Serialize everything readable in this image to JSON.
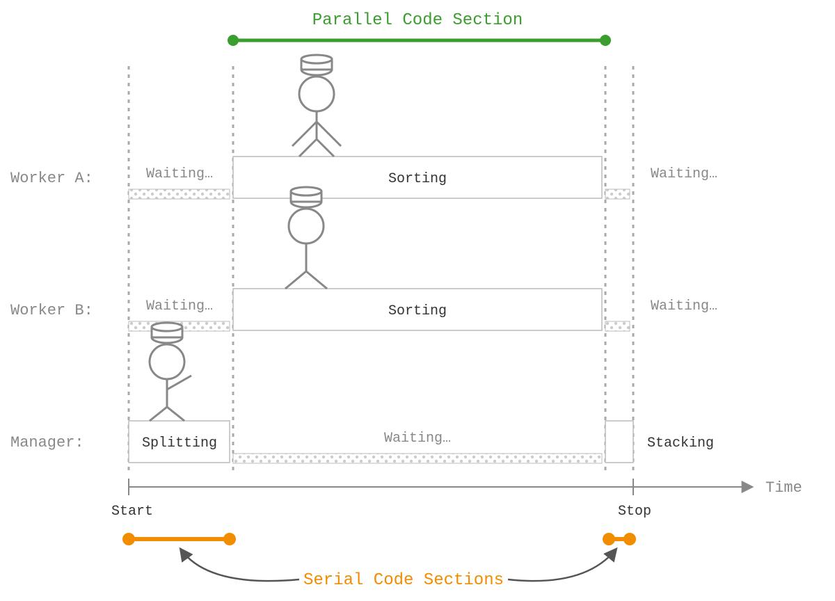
{
  "title_parallel": "Parallel Code Section",
  "title_serial": "Serial Code Sections",
  "axis_label": "Time",
  "tick_start": "Start",
  "tick_stop": "Stop",
  "lanes": {
    "workerA": {
      "label": "Worker A:",
      "wait1": "Waiting…",
      "task": "Sorting",
      "wait2": "Waiting…"
    },
    "workerB": {
      "label": "Worker B:",
      "wait1": "Waiting…",
      "task": "Sorting",
      "wait2": "Waiting…"
    },
    "manager": {
      "label": "Manager:",
      "task1": "Splitting",
      "wait": "Waiting…",
      "task2": "Stacking"
    }
  },
  "colors": {
    "green": "#3a9e2e",
    "orange": "#f28c00",
    "grey": "#888",
    "box": "#bbb"
  },
  "chart_data": {
    "type": "table",
    "title": "Parallel vs Serial execution timeline",
    "axis": "Time",
    "sections": {
      "parallel": {
        "start": 335,
        "end": 870
      },
      "serial": [
        {
          "start": 185,
          "end": 330
        },
        {
          "start": 870,
          "end": 910
        }
      ]
    },
    "lanes": [
      {
        "name": "Worker A",
        "segments": [
          {
            "label": "Waiting…",
            "start": 185,
            "end": 330,
            "type": "wait"
          },
          {
            "label": "Sorting",
            "start": 335,
            "end": 865,
            "type": "work"
          },
          {
            "label": "Waiting…",
            "start": 870,
            "end": 905,
            "type": "wait"
          }
        ]
      },
      {
        "name": "Worker B",
        "segments": [
          {
            "label": "Waiting…",
            "start": 185,
            "end": 330,
            "type": "wait"
          },
          {
            "label": "Sorting",
            "start": 335,
            "end": 865,
            "type": "work"
          },
          {
            "label": "Waiting…",
            "start": 870,
            "end": 905,
            "type": "wait"
          }
        ]
      },
      {
        "name": "Manager",
        "segments": [
          {
            "label": "Splitting",
            "start": 185,
            "end": 330,
            "type": "work"
          },
          {
            "label": "Waiting…",
            "start": 335,
            "end": 865,
            "type": "wait"
          },
          {
            "label": "Stacking",
            "start": 870,
            "end": 910,
            "type": "work"
          }
        ]
      }
    ]
  }
}
